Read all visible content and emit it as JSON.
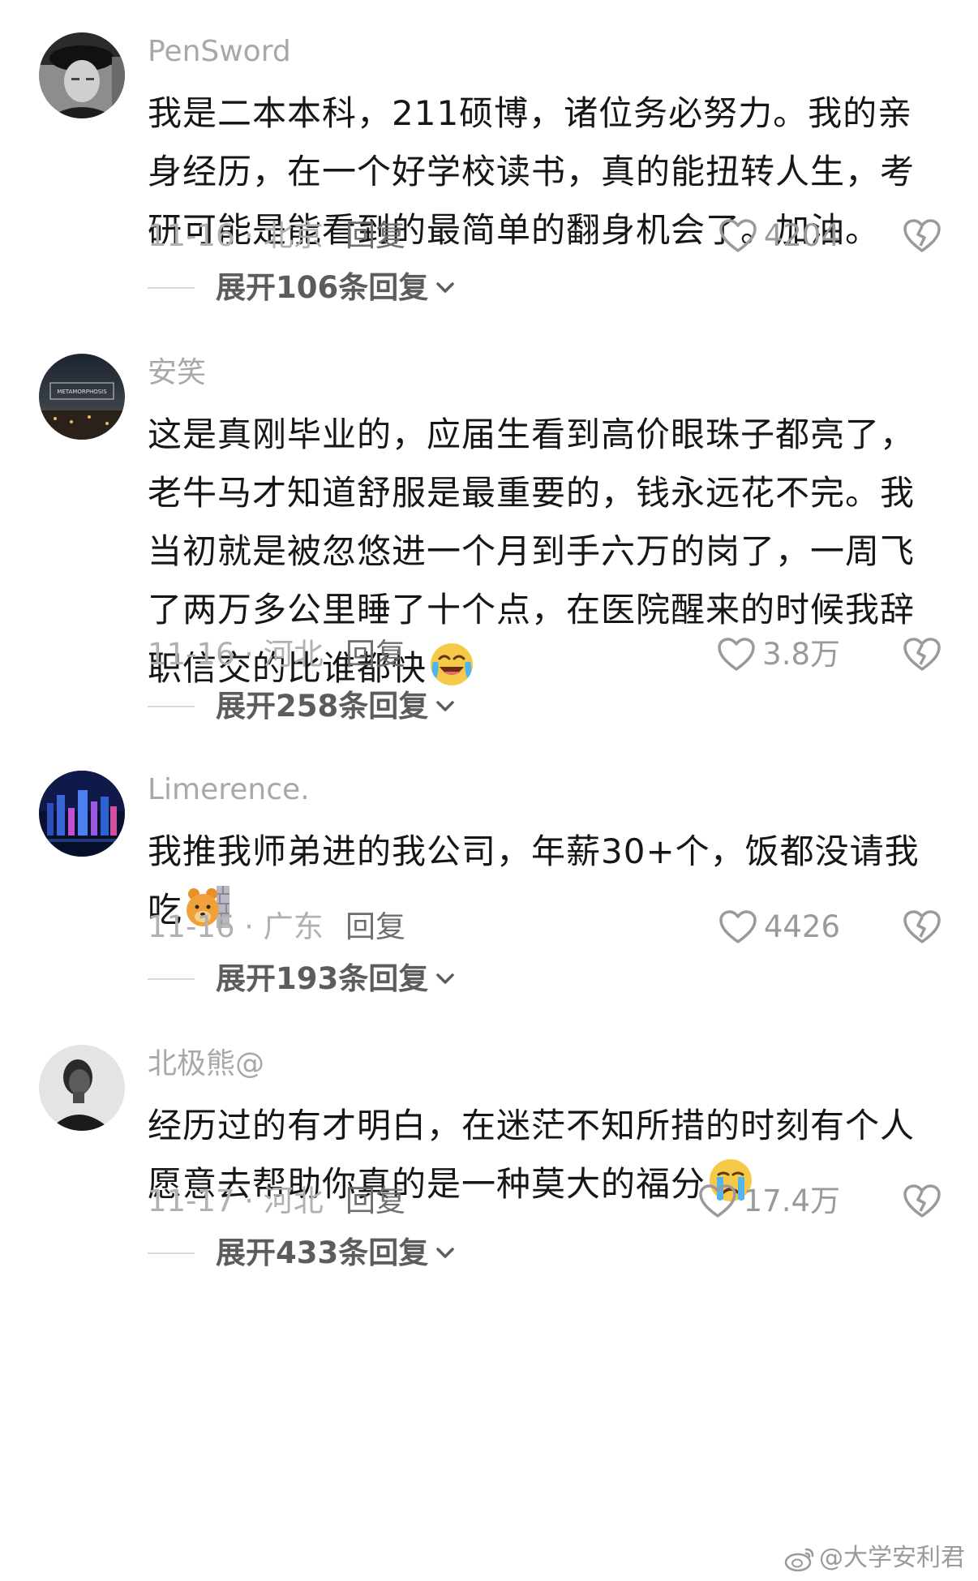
{
  "comments": [
    {
      "username": "PenSword",
      "text_lines": [
        "我是二本本科，211硕博，诸位务必努力。我的亲",
        "身经历，在一个好学校读书，真的能扭转人生，考",
        "研可能是能看到的最简单的翻身机会了。加油。"
      ],
      "emoji": null,
      "date": "11-16 · 北京",
      "reply_label": "回复",
      "likes": "4204",
      "expand_label": "展开106条回复"
    },
    {
      "username": "安笑",
      "text_lines": [
        "这是真刚毕业的，应届生看到高价眼珠子都亮了，",
        "老牛马才知道舒服是最重要的，钱永远花不完。我",
        "当初就是被忽悠进一个月到手六万的岗了，一周飞",
        "了两万多公里睡了十个点，在医院醒来的时候我辞",
        "职信交的比谁都快"
      ],
      "emoji": "crying-laughing-face-emoji",
      "date": "11-16 · 河北",
      "reply_label": "回复",
      "likes": "3.8万",
      "expand_label": "展开258条回复",
      "avatar_text": "METAMORPHOSIS"
    },
    {
      "username": "Limerence.",
      "text_lines": [
        "我推我师弟进的我公司，年薪30+个，饭都没请我",
        "吃"
      ],
      "emoji": "bear-behind-wall-emoji",
      "date": "11-16 · 广东",
      "reply_label": "回复",
      "likes": "4426",
      "expand_label": "展开193条回复"
    },
    {
      "username": "北极熊@",
      "text_lines": [
        "经历过的有才明白，在迷茫不知所措的时刻有个人",
        "愿意去帮助你真的是一种莫大的福分"
      ],
      "emoji": "crying-face-emoji",
      "date": "11-17 · 河北",
      "reply_label": "回复",
      "likes": "17.4万",
      "expand_label": "展开433条回复"
    }
  ],
  "watermark": "@大学安利君",
  "icons": {
    "like": "heart-outline-icon",
    "dislike": "broken-heart-icon",
    "expand": "chevron-down-icon",
    "watermark": "weibo-logo-icon"
  },
  "colors": {
    "username": "#a8a8a8",
    "text": "#161616",
    "meta": "#b0b0b0",
    "reply": "#6e6e6e",
    "expand": "#5c5c5c"
  }
}
